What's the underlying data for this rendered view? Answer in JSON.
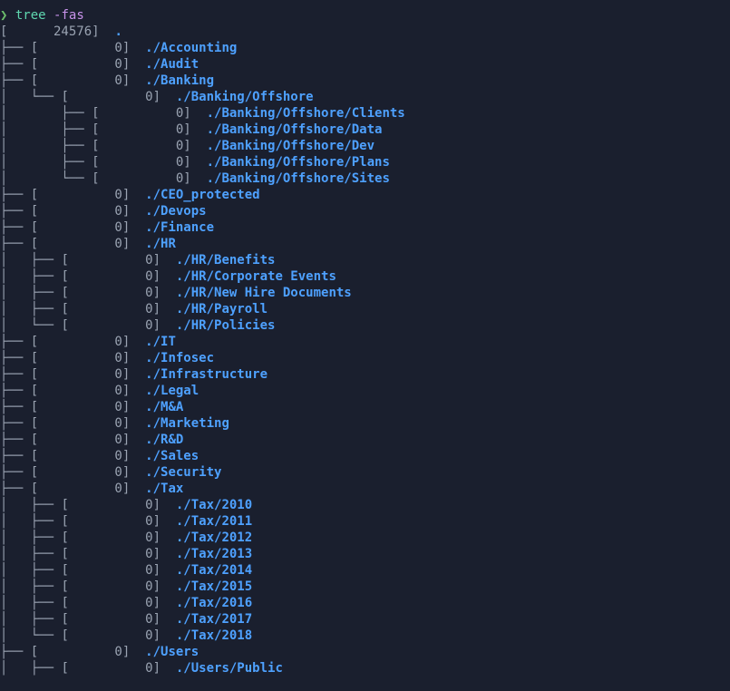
{
  "prompt": "❯",
  "command": "tree",
  "flags": "-fas",
  "root_size": "24576",
  "zero": "0",
  "root": ".",
  "entries": [
    {
      "name": "./Accounting",
      "depth": 0,
      "last": false
    },
    {
      "name": "./Audit",
      "depth": 0,
      "last": false
    },
    {
      "name": "./Banking",
      "depth": 0,
      "last": false,
      "children": [
        {
          "name": "./Banking/Offshore",
          "depth": 1,
          "last": true,
          "children": [
            {
              "name": "./Banking/Offshore/Clients",
              "depth": 2,
              "last": false
            },
            {
              "name": "./Banking/Offshore/Data",
              "depth": 2,
              "last": false
            },
            {
              "name": "./Banking/Offshore/Dev",
              "depth": 2,
              "last": false
            },
            {
              "name": "./Banking/Offshore/Plans",
              "depth": 2,
              "last": false
            },
            {
              "name": "./Banking/Offshore/Sites",
              "depth": 2,
              "last": true
            }
          ]
        }
      ]
    },
    {
      "name": "./CEO_protected",
      "depth": 0,
      "last": false
    },
    {
      "name": "./Devops",
      "depth": 0,
      "last": false
    },
    {
      "name": "./Finance",
      "depth": 0,
      "last": false
    },
    {
      "name": "./HR",
      "depth": 0,
      "last": false,
      "children": [
        {
          "name": "./HR/Benefits",
          "depth": 1,
          "last": false
        },
        {
          "name": "./HR/Corporate Events",
          "depth": 1,
          "last": false
        },
        {
          "name": "./HR/New Hire Documents",
          "depth": 1,
          "last": false
        },
        {
          "name": "./HR/Payroll",
          "depth": 1,
          "last": false
        },
        {
          "name": "./HR/Policies",
          "depth": 1,
          "last": true
        }
      ]
    },
    {
      "name": "./IT",
      "depth": 0,
      "last": false
    },
    {
      "name": "./Infosec",
      "depth": 0,
      "last": false
    },
    {
      "name": "./Infrastructure",
      "depth": 0,
      "last": false
    },
    {
      "name": "./Legal",
      "depth": 0,
      "last": false
    },
    {
      "name": "./M&A",
      "depth": 0,
      "last": false
    },
    {
      "name": "./Marketing",
      "depth": 0,
      "last": false
    },
    {
      "name": "./R&D",
      "depth": 0,
      "last": false
    },
    {
      "name": "./Sales",
      "depth": 0,
      "last": false
    },
    {
      "name": "./Security",
      "depth": 0,
      "last": false
    },
    {
      "name": "./Tax",
      "depth": 0,
      "last": false,
      "children": [
        {
          "name": "./Tax/2010",
          "depth": 1,
          "last": false
        },
        {
          "name": "./Tax/2011",
          "depth": 1,
          "last": false
        },
        {
          "name": "./Tax/2012",
          "depth": 1,
          "last": false
        },
        {
          "name": "./Tax/2013",
          "depth": 1,
          "last": false
        },
        {
          "name": "./Tax/2014",
          "depth": 1,
          "last": false
        },
        {
          "name": "./Tax/2015",
          "depth": 1,
          "last": false
        },
        {
          "name": "./Tax/2016",
          "depth": 1,
          "last": false
        },
        {
          "name": "./Tax/2017",
          "depth": 1,
          "last": false
        },
        {
          "name": "./Tax/2018",
          "depth": 1,
          "last": true
        }
      ]
    },
    {
      "name": "./Users",
      "depth": 0,
      "last": false,
      "children": [
        {
          "name": "./Users/Public",
          "depth": 1,
          "last": false
        }
      ]
    }
  ]
}
